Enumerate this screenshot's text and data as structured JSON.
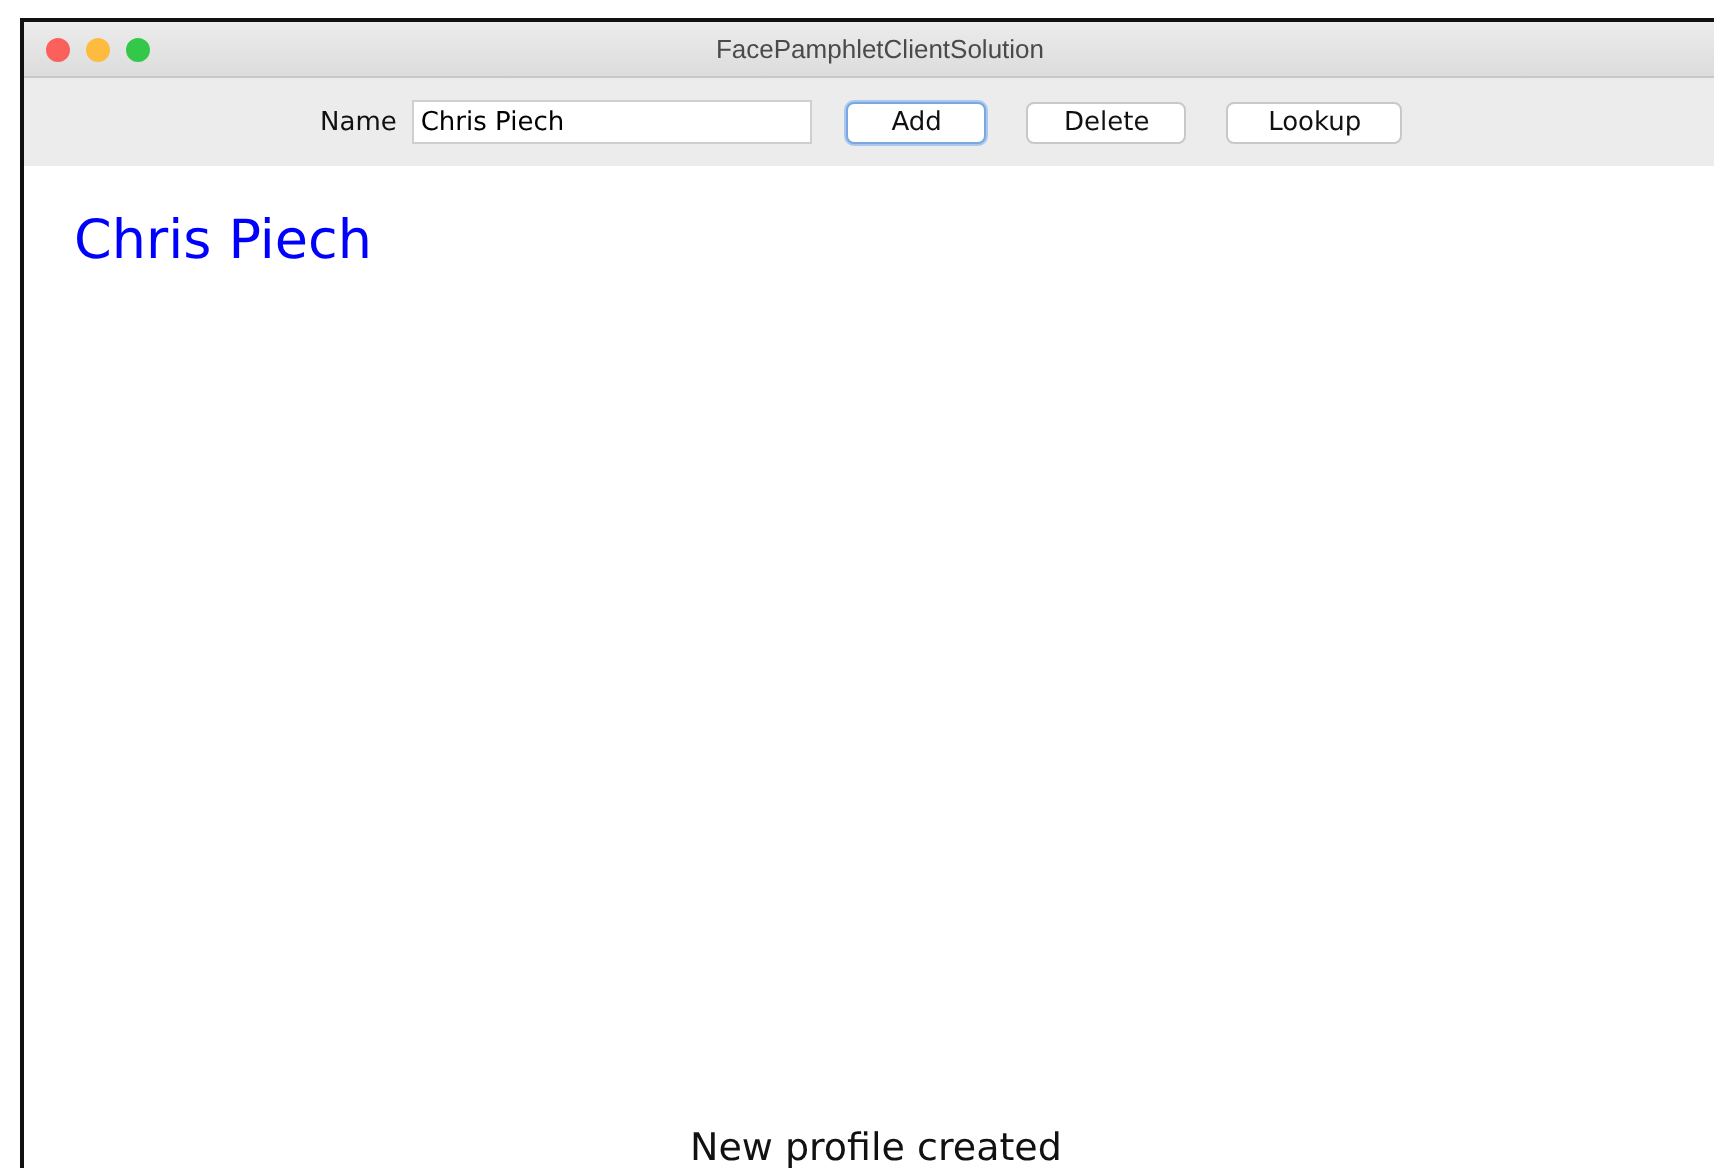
{
  "window": {
    "title": "FacePamphletClientSolution"
  },
  "toolbar": {
    "name_label": "Name",
    "name_field": {
      "value": "Chris Piech"
    },
    "buttons": [
      {
        "label": "Add",
        "focused": true
      },
      {
        "label": "Delete",
        "focused": false
      },
      {
        "label": "Lookup",
        "focused": false
      }
    ]
  },
  "profile": {
    "name": "Chris Piech"
  },
  "status_bar": {
    "message": "New profile created"
  }
}
